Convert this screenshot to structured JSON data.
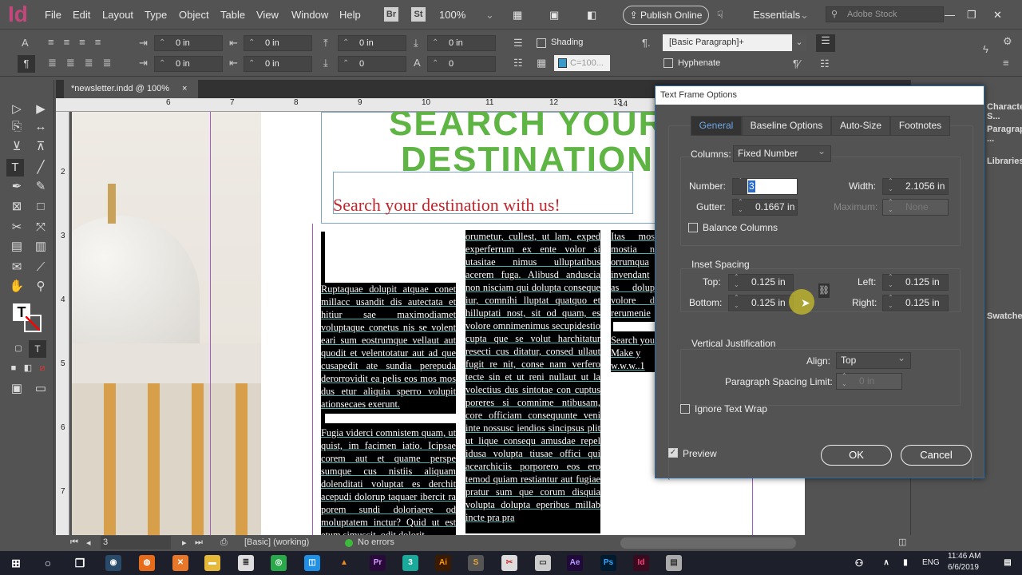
{
  "app": {
    "logo": "Id",
    "menu": [
      "File",
      "Edit",
      "Layout",
      "Type",
      "Object",
      "Table",
      "View",
      "Window",
      "Help"
    ],
    "bridge": "Br",
    "stock_btn": "St",
    "zoom": "100%",
    "publish": "Publish Online",
    "workspace": "Essentials",
    "search_placeholder": "Adobe Stock"
  },
  "control": {
    "left_indent": "0 in",
    "right_indent": "0 in",
    "space_before": "0 in",
    "space_after": "0 in",
    "first_line_indent": "0 in",
    "last_line_indent": "0 in",
    "drop_cap_lines": "0",
    "drop_cap_chars": "0",
    "shading": "Shading",
    "swatch": "C=100...",
    "paragraph_style": "[Basic Paragraph]+",
    "hyphenate": "Hyphenate"
  },
  "document": {
    "tab": "*newsletter.indd @ 100%",
    "close": "×",
    "ruler_top": [
      "6",
      "7",
      "8",
      "9",
      "10",
      "11",
      "12",
      "13",
      "14"
    ],
    "ruler_left": [
      "2",
      "3",
      "4",
      "5",
      "6",
      "7"
    ],
    "heading_line1": "SEARCH YOUR",
    "heading_line2": "DESTINATION",
    "subtitle": "Search your destination with us!",
    "col1_p1": "Ruptaquae dolupit atquae conet millacc usandit dis autectata et hitiur sae maximodiamet voluptaque conetus nis se volent eari sum eostrumque vellaut aut quodit et velentotatur aut ad que cusapedit ate sundia perepuda derorrovidit ea pelis eos mos mos dus etur aliquia sperro volupit ationsecaes exerunt.",
    "col1_p2": "Fugia viderci comnistem quam, ut quist, im facimen iatio. Icipsae corem aut et quame perspe sumque cus nistiis aliquam dolenditati voluptat es derchit acepudi dolorup taquaer ibercit ra porem sundi doloriaere od moluptatem inctur? Quid ut est etum simuscit, odit dolorit",
    "col2_p1": "orumetur, cullest, ut lam, exped experferrum ex ente volor si utasitae nimus ulluptatibus acerem fuga. Alibusd anduscia non nisciam qui dolupta conseque iur, comnihi lluptat quatquo et hilluptati nost, sit od quam, es volore omnimenimus secupidestio cupta que se volut harchitatur resecti cus ditatur, consed ullaut fugit re nit, conse nam verfero tecte sin et ut reni nullaut ut la volectius dus sintotae con cuptus poreres si comnime ntibusam, core officiam consequunte veni inte nossusc iendios sincipsus plit ut lique consequ amusdae repel idusa volupta tiusae offici qui acearchiciis porporero eos ero temod quiam restiantur aut fugiae pratur sum que corum disquia volupta dolupta eperibus millab incte pra pra",
    "col3_p1": "Itas mos mostia n orrumqua invendant as dolup volore d rerumenie",
    "col3_p2": "Search you Make y w.w.w..1"
  },
  "statusbar": {
    "page": "3",
    "style": "[Basic] (working)",
    "errors": "No errors"
  },
  "right_panel": [
    "Character S...",
    "Paragraph ...",
    "Libraries",
    "Swatches"
  ],
  "dialog": {
    "title": "Text Frame Options",
    "tabs": [
      "General",
      "Baseline Options",
      "Auto-Size",
      "Footnotes"
    ],
    "columns_label": "Columns:",
    "columns_value": "Fixed Number",
    "number_label": "Number:",
    "number_value": "3",
    "width_label": "Width:",
    "width_value": "2.1056 in",
    "gutter_label": "Gutter:",
    "gutter_value": "0.1667 in",
    "maximum_label": "Maximum:",
    "maximum_value": "None",
    "balance": "Balance Columns",
    "inset_title": "Inset Spacing",
    "top_label": "Top:",
    "top_value": "0.125 in",
    "bottom_label": "Bottom:",
    "bottom_value": "0.125 in",
    "left_label": "Left:",
    "left_value": "0.125 in",
    "right_label": "Right:",
    "right_value": "0.125 in",
    "vj_title": "Vertical Justification",
    "align_label": "Align:",
    "align_value": "Top",
    "psl_label": "Paragraph Spacing Limit:",
    "psl_value": "0 in",
    "ignore_wrap": "Ignore Text Wrap",
    "preview": "Preview",
    "ok": "OK",
    "cancel": "Cancel"
  },
  "taskbar": {
    "time": "11:46 AM",
    "date": "6/6/2019",
    "lang": "ENG",
    "apps": [
      "Pr",
      "3",
      "Ai",
      "S",
      "Ae",
      "Ps",
      "Id"
    ]
  }
}
